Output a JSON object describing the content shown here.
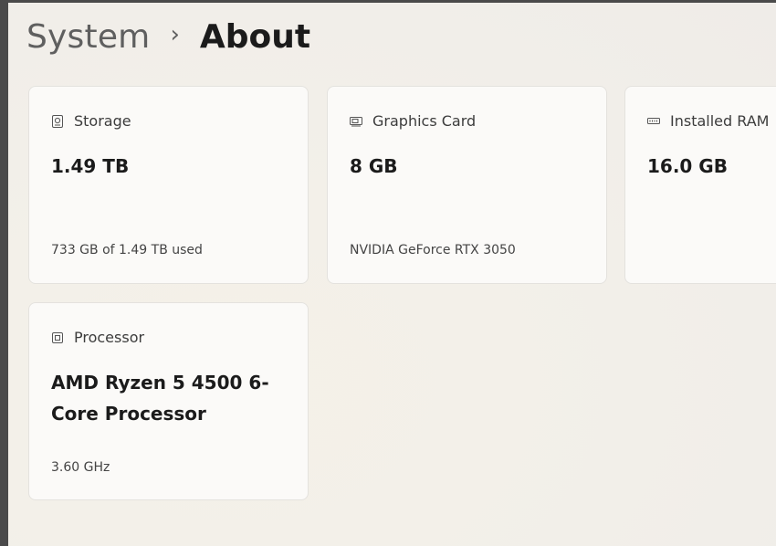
{
  "breadcrumb": {
    "parent": "System",
    "separator": "›",
    "current": "About"
  },
  "cards": {
    "storage": {
      "icon": "storage-icon",
      "title": "Storage",
      "value": "1.49 TB",
      "detail": "733 GB of 1.49 TB used"
    },
    "graphics": {
      "icon": "graphics-card-icon",
      "title": "Graphics Card",
      "value": "8 GB",
      "detail": "NVIDIA GeForce RTX 3050"
    },
    "ram": {
      "icon": "ram-icon",
      "title": "Installed RAM",
      "value": "16.0 GB"
    },
    "processor": {
      "icon": "processor-icon",
      "title": "Processor",
      "value": "AMD Ryzen 5 4500 6-Core Processor",
      "detail": "3.60 GHz"
    }
  }
}
